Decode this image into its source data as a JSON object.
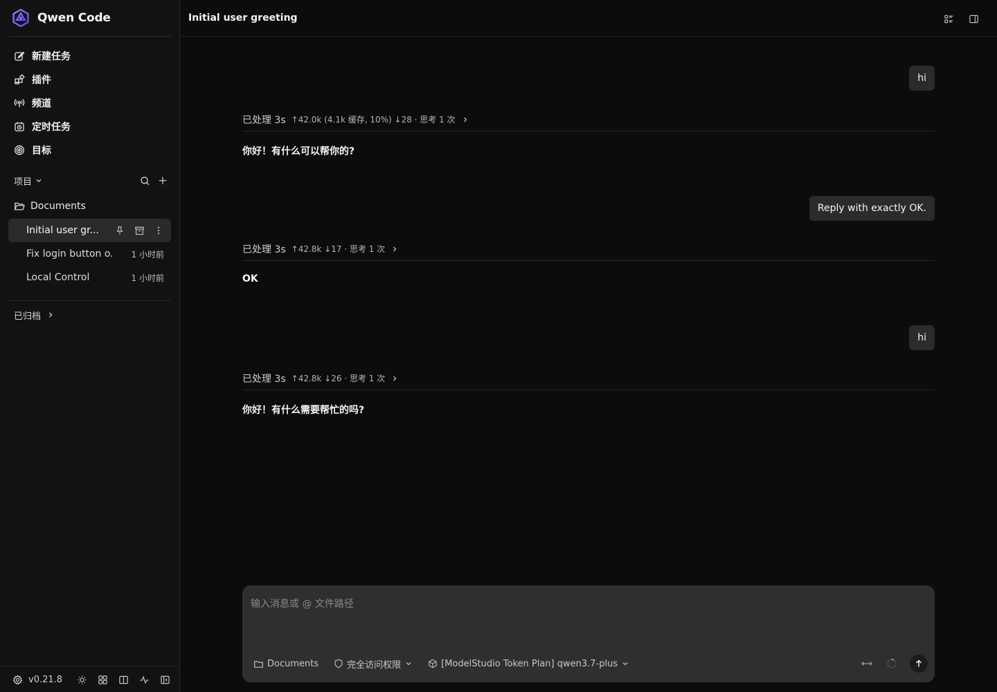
{
  "app": {
    "name": "Qwen Code",
    "version": "v0.21.8"
  },
  "sidebar": {
    "nav": [
      {
        "label": "新建任务",
        "icon": "edit-icon"
      },
      {
        "label": "插件",
        "icon": "plugin-icon"
      },
      {
        "label": "频道",
        "icon": "broadcast-icon"
      },
      {
        "label": "定时任务",
        "icon": "scheduled-task-icon"
      },
      {
        "label": "目标",
        "icon": "target-icon"
      }
    ],
    "projects_label": "项目",
    "folder": "Documents",
    "threads": [
      {
        "title": "Initial user gr...",
        "time": "",
        "active": true
      },
      {
        "title": "Fix login button o...",
        "time": "1 小时前",
        "active": false
      },
      {
        "title": "Local Control",
        "time": "1 小时前",
        "active": false
      }
    ],
    "archived_label": "已归档"
  },
  "header": {
    "title": "Initial user greeting"
  },
  "messages": [
    {
      "role": "user",
      "text": "hi"
    },
    {
      "role": "assistant",
      "meta_a": "已处理 3s",
      "meta_b": "↑42.0k (4.1k 缓存, 10%) ↓28 · 思考 1 次",
      "text": "你好！有什么可以帮你的?"
    },
    {
      "role": "user",
      "text": "Reply with exactly OK."
    },
    {
      "role": "assistant",
      "meta_a": "已处理 3s",
      "meta_b": "↑42.8k ↓17 · 思考 1 次",
      "text": "OK"
    },
    {
      "role": "user",
      "text": "hi"
    },
    {
      "role": "assistant",
      "meta_a": "已处理 3s",
      "meta_b": "↑42.8k ↓26 · 思考 1 次",
      "text": "你好！有什么需要帮忙的吗?"
    }
  ],
  "composer": {
    "placeholder": "输入消息或 @ 文件路径",
    "value": "",
    "folder": "Documents",
    "permission": "完全访问权限",
    "model": "[ModelStudio Token Plan] qwen3.7-plus"
  },
  "colors": {
    "background": "#0c0c0d",
    "sidebar": "#121213",
    "bubble": "#2b2b2c",
    "composer": "#2f2f30",
    "brand": "#7b61ff"
  }
}
